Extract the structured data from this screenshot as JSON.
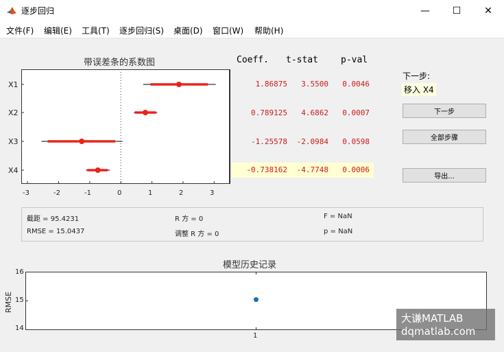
{
  "window": {
    "title": "逐步回归",
    "minimize": "—",
    "maximize": "☐",
    "close": "✕"
  },
  "menu": [
    "文件(F)",
    "编辑(E)",
    "工具(T)",
    "逐步回归(S)",
    "桌面(D)",
    "窗口(W)",
    "帮助(H)"
  ],
  "coef_plot": {
    "title": "带误差条的系数图",
    "x_ticks": [
      "-3",
      "-2",
      "-1",
      "0",
      "1",
      "2",
      "3"
    ],
    "xlim": [
      -3.2,
      3.5
    ],
    "variables": [
      "X1",
      "X2",
      "X3",
      "X4"
    ],
    "estimates": [
      1.86875,
      0.789125,
      -1.25578,
      -0.738162
    ],
    "ci_inner": [
      [
        0.95,
        2.8
      ],
      [
        0.45,
        1.13
      ],
      [
        -2.35,
        -0.18
      ],
      [
        -1.08,
        -0.42
      ]
    ],
    "ci_outer": [
      [
        0.72,
        3.05
      ],
      [
        0.42,
        1.17
      ],
      [
        -2.55,
        0.05
      ],
      [
        -1.12,
        -0.35
      ]
    ],
    "zero_line": true,
    "colors": {
      "bar": "#e8241c",
      "outer": "#333333",
      "point": "#e8241c"
    }
  },
  "table": {
    "headers": [
      "Coeff.",
      "t-stat",
      "p-val"
    ],
    "rows": [
      {
        "coeff": "1.86875",
        "tstat": "3.5500",
        "pval": "0.0046",
        "selected": false
      },
      {
        "coeff": "0.789125",
        "tstat": "4.6862",
        "pval": "0.0007",
        "selected": false
      },
      {
        "coeff": "-1.25578",
        "tstat": "-2.0984",
        "pval": "0.0598",
        "selected": false
      },
      {
        "coeff": "-0.738162",
        "tstat": "-4.7748",
        "pval": "0.0006",
        "selected": true
      }
    ]
  },
  "next_step": {
    "label": "下一步:",
    "value": "移入 X4"
  },
  "buttons": {
    "next": "下一步",
    "all_steps": "全部步骤",
    "export": "导出..."
  },
  "stats": {
    "intercept": "截距 = 95.4231",
    "rmse": "RMSE = 15.0437",
    "r2": "R 方 = 0",
    "adj_r2": "调整 R 方 = 0",
    "f": "F = NaN",
    "p": "p = NaN"
  },
  "chart_data": {
    "type": "scatter",
    "title": "模型历史记录",
    "ylabel": "RMSE",
    "xlabel": "",
    "x": [
      1
    ],
    "y": [
      15.0437
    ],
    "x_ticks": [
      "1"
    ],
    "y_ticks": [
      "14",
      "15",
      "16"
    ],
    "xlim": [
      0,
      2
    ],
    "ylim": [
      14,
      16
    ],
    "color": "#1f6fb2"
  },
  "watermark": {
    "line1": "大谦MATLAB",
    "line2": "dqmatlab.com"
  }
}
